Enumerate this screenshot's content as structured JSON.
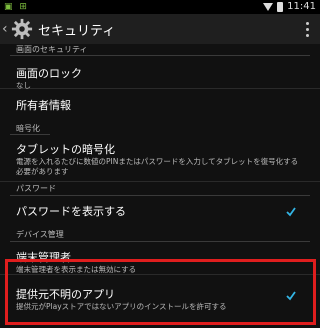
{
  "status_bar": {
    "left_icons": "▣ ⊞",
    "time": "11:41",
    "wifi_icon": "wifi-icon",
    "battery_icon": "battery-icon"
  },
  "action_bar": {
    "title": "セキュリティ",
    "icon": "gear-icon",
    "menu_icon": "overflow-menu-icon"
  },
  "sections": [
    {
      "header": "画面のセキュリティ",
      "items": [
        {
          "title": "画面のロック",
          "summary": "なし"
        },
        {
          "title": "所有者情報"
        }
      ]
    },
    {
      "header": "暗号化",
      "items": [
        {
          "title": "タブレットの暗号化",
          "summary": "電源を入れるたびに数値のPINまたはパスワードを入力してタブレットを復号化する必要があります"
        }
      ]
    },
    {
      "header": "パスワード",
      "items": [
        {
          "title": "パスワードを表示する",
          "checked": true
        }
      ]
    },
    {
      "header": "デバイス管理",
      "items": [
        {
          "title": "端末管理者",
          "summary": "端末管理者を表示または無効にする"
        },
        {
          "title": "提供元不明のアプリ",
          "summary": "提供元がPlayストアではないアプリのインストールを許可する",
          "checked": true
        }
      ]
    }
  ],
  "colors": {
    "check": "#33b5e5",
    "highlight": "#e01e1e",
    "background": "#111111"
  }
}
